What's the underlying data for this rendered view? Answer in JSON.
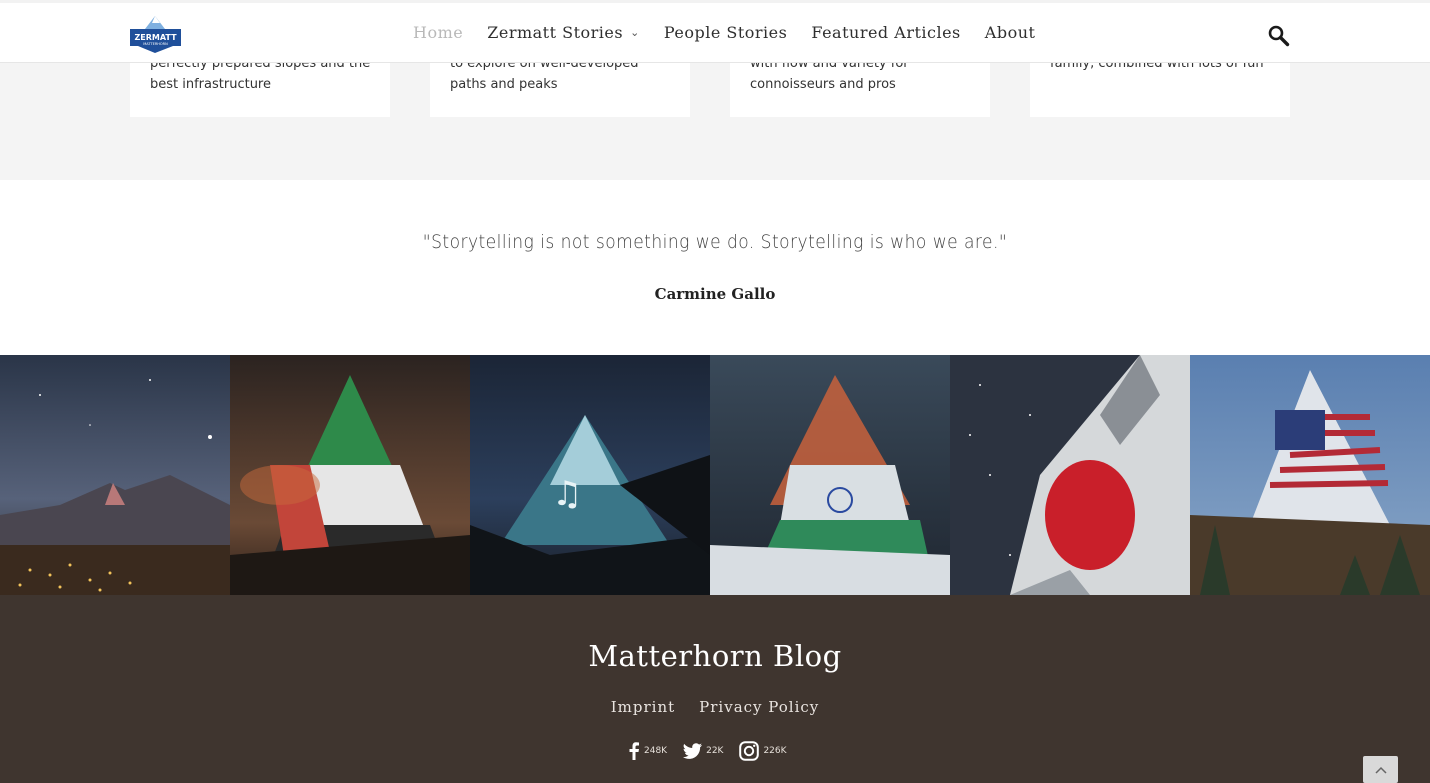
{
  "header": {
    "logo_text": "ZERMATT",
    "logo_subtext": "MATTERHORN",
    "nav": [
      {
        "label": "Home"
      },
      {
        "label": "Zermatt Stories"
      },
      {
        "label": "People Stories"
      },
      {
        "label": "Featured Articles"
      },
      {
        "label": "About"
      }
    ],
    "search_icon": "search-icon"
  },
  "cards": [
    {
      "text": "perfectly prepared slopes and the best infrastructure"
    },
    {
      "text": "to explore on well-developed paths and peaks"
    },
    {
      "text": "with flow and variety for connoisseurs and pros"
    },
    {
      "text": "family, combined with lots of fun"
    }
  ],
  "quote": {
    "text": "\"Storytelling is not something we do. Storytelling is who we are.\"",
    "author": "Carmine Gallo"
  },
  "gallery": [
    {
      "icon": "matterhorn-night-village-image"
    },
    {
      "icon": "matterhorn-uae-flag-image"
    },
    {
      "icon": "matterhorn-music-note-image"
    },
    {
      "icon": "matterhorn-india-flag-image"
    },
    {
      "icon": "matterhorn-japan-flag-image"
    },
    {
      "icon": "matterhorn-usa-flag-image"
    }
  ],
  "footer": {
    "title": "Matterhorn Blog",
    "links": [
      "Imprint",
      "Privacy Policy"
    ],
    "social": [
      {
        "icon": "facebook-icon",
        "count": "248K"
      },
      {
        "icon": "twitter-icon",
        "count": "22K"
      },
      {
        "icon": "instagram-icon",
        "count": "226K"
      }
    ]
  },
  "colors": {
    "footer_bg": "#3f352f",
    "active_nav": "#b9b9b9",
    "logo_blue": "#1f4f9a"
  }
}
